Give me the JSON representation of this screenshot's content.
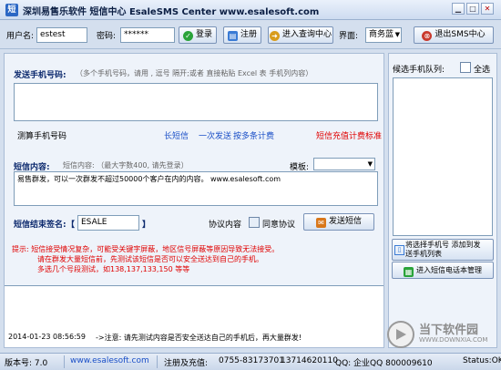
{
  "window": {
    "title": "深圳易售乐软件 短信中心 EsaleSMS Center  www.esalesoft.com"
  },
  "toolbar": {
    "username_label": "用户名:",
    "username_value": "estest",
    "password_label": "密码:",
    "password_value": "******",
    "login_label": "登录",
    "register_label": "注册",
    "query_center_label": "进入查询中心",
    "interface_label": "界面:",
    "interface_value": "商务蓝",
    "exit_label": "退出SMS中心"
  },
  "phones": {
    "title": "发送手机号码:",
    "hint": "（多个手机号码，请用 , 逗号  隔开;或者  直接粘贴 Excel 表 手机列内容）",
    "count_label": "测算手机号码",
    "links": [
      "长短信",
      "一次发送",
      "按多条计费"
    ],
    "pricing_link": "短信充值计费标准"
  },
  "content": {
    "title": "短信内容:",
    "hint": "短信内容: （最大字数400, 请先登录）",
    "template_label": "模板:",
    "message": "易售群发，可以一次群发不超过50000个客户在内的内容。 www.esalesoft.com"
  },
  "signature": {
    "label": "短信结束签名:",
    "bracket_open": "【",
    "value": "ESALE",
    "bracket_close": "】",
    "agreement_label": "协议内容",
    "agree_checkbox_label": "同意协议",
    "send_label": "发送短信"
  },
  "notice": {
    "lines": [
      "提示: 短信接受情况复杂，可能受关键字屏蔽，地区信号屏蔽等原因导致无法接受。",
      "请在群发大量短信前，先测试该短信是否可以安全送达到自己的手机。",
      "多选几个号段测试，如138,137,133,150  等等"
    ]
  },
  "log": {
    "timestamp": "2014-01-23  08:56:59",
    "message": "->注意: 请先测试内容是否安全送达自己的手机后，再大量群发!"
  },
  "right_panel": {
    "title": "候选手机队列:",
    "select_all": "全选",
    "add_button_line1": "将选择手机号 添加到发",
    "add_button_line2": "送手机列表",
    "phonebook_button": "进入短信电话本管理"
  },
  "status": {
    "version": "版本号: 7.0",
    "website": "www.esalesoft.com",
    "consult_label": "注册及充值:",
    "phone": "0755-83173701",
    "mobile": "13714620110",
    "qq": "QQ: 企业QQ 800009610",
    "status": "Status:OK"
  },
  "watermark": {
    "text_cn": "当下软件园",
    "text_en": "WWW.DOWNXIA.COM"
  },
  "colors": {
    "accent": "#0d2a6e",
    "warning": "#e00000",
    "link": "#1a4fc7"
  }
}
